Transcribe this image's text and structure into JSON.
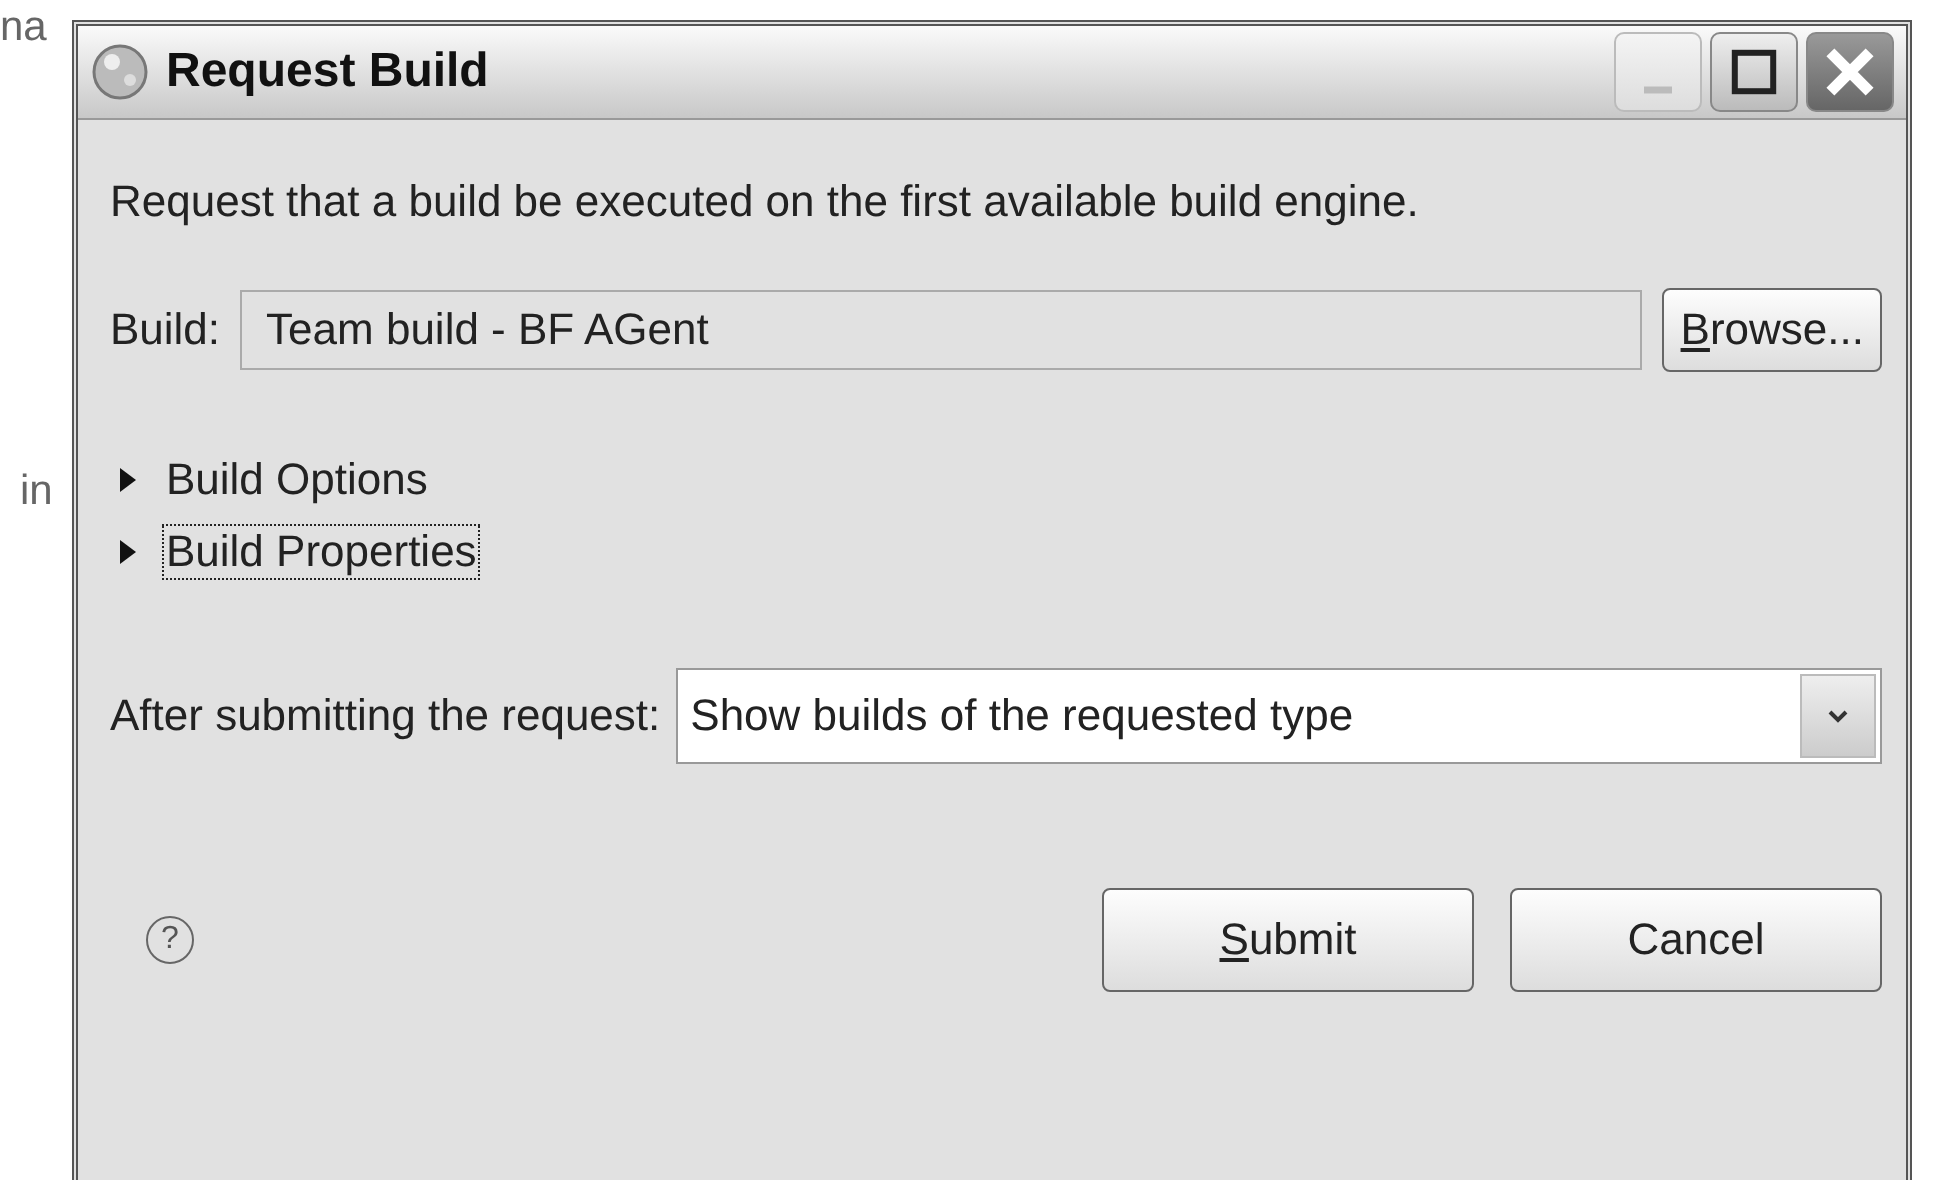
{
  "background_texts": [
    "na",
    "in"
  ],
  "window": {
    "title": "Request Build"
  },
  "description": "Request that a build be executed on the first available build engine.",
  "build": {
    "label": "Build:",
    "value": "Team build - BF AGent",
    "browse": {
      "mnemonic": "B",
      "rest": "rowse..."
    }
  },
  "sections": [
    {
      "label": "Build Options",
      "expanded": false,
      "focused": false
    },
    {
      "label": "Build Properties",
      "expanded": false,
      "focused": true
    }
  ],
  "after_submit": {
    "label": "After submitting the request:",
    "value": "Show builds of the requested type"
  },
  "help": {
    "glyph": "?"
  },
  "buttons": [
    {
      "mnemonic": "S",
      "rest": "ubmit"
    },
    {
      "rest": "Cancel"
    }
  ]
}
